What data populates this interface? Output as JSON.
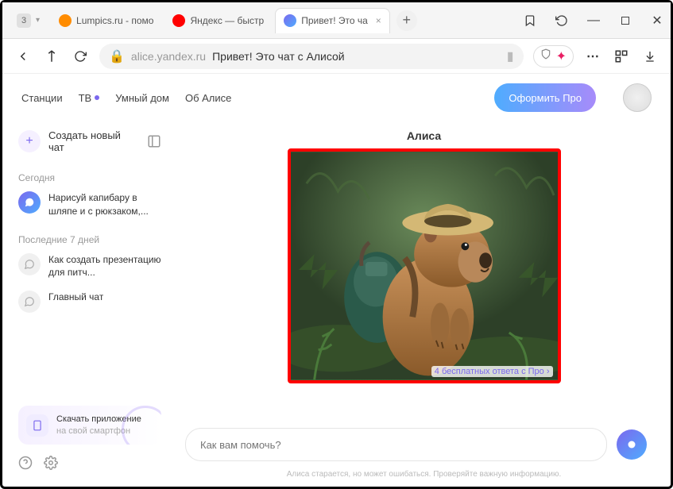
{
  "tabs": [
    {
      "badge": "3",
      "label": ""
    },
    {
      "icon": "#ff6600",
      "label": "Lumpics.ru - помо"
    },
    {
      "icon": "#ff0000",
      "label": "Яндекс — быстр"
    },
    {
      "icon": "gradient",
      "label": "Привет! Это ча",
      "active": true
    }
  ],
  "address": {
    "domain": "alice.yandex.ru",
    "title": "Привет! Это чат с Алисой"
  },
  "topnav": {
    "items": [
      "Станции",
      "ТВ",
      "Умный дом",
      "Об Алисе"
    ],
    "pro_button": "Оформить Про"
  },
  "sidebar": {
    "new_chat": "Создать новый чат",
    "sections": [
      {
        "label": "Сегодня",
        "items": [
          {
            "text": "Нарисуй капибару в шляпе и с рюкзаком,...",
            "active": true
          }
        ]
      },
      {
        "label": "Последние 7 дней",
        "items": [
          {
            "text": "Как создать презентацию для питч..."
          },
          {
            "text": "Главный чат"
          }
        ]
      }
    ],
    "app_card": {
      "line1": "Скачать приложение",
      "line2": "на свой смартфон"
    }
  },
  "chat": {
    "name": "Алиса",
    "free_badge": "4 бесплатных ответа с Про",
    "input_placeholder": "Как вам помочь?",
    "disclaimer": "Алиса старается, но может ошибаться. Проверяйте важную информацию."
  }
}
